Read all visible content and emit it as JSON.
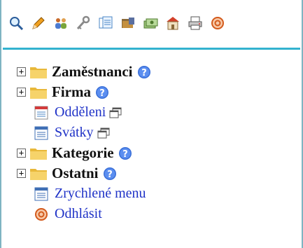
{
  "toolbar": {
    "icons": [
      {
        "name": "search-icon"
      },
      {
        "name": "pencil-icon"
      },
      {
        "name": "users-icon"
      },
      {
        "name": "key-icon"
      },
      {
        "name": "documents-icon"
      },
      {
        "name": "folder-tools-icon"
      },
      {
        "name": "money-icon"
      },
      {
        "name": "building-icon"
      },
      {
        "name": "print-icon"
      },
      {
        "name": "logout-icon"
      }
    ]
  },
  "tree": {
    "items": [
      {
        "label": "Zaměstnanci",
        "type": "folder"
      },
      {
        "label": "Firma",
        "type": "folder"
      },
      {
        "label": "Odděleni",
        "type": "page"
      },
      {
        "label": "Svátky",
        "type": "page"
      },
      {
        "label": "Kategorie",
        "type": "folder"
      },
      {
        "label": "Ostatni",
        "type": "folder"
      },
      {
        "label": "Zrychlené menu",
        "type": "link"
      },
      {
        "label": "Odhlásit",
        "type": "logout"
      }
    ],
    "expander_symbol": "+"
  },
  "colors": {
    "accent_rule": "#33b2cf",
    "link": "#1f32c7",
    "folder": "#f2c64a",
    "help": "#3a6fd8"
  }
}
